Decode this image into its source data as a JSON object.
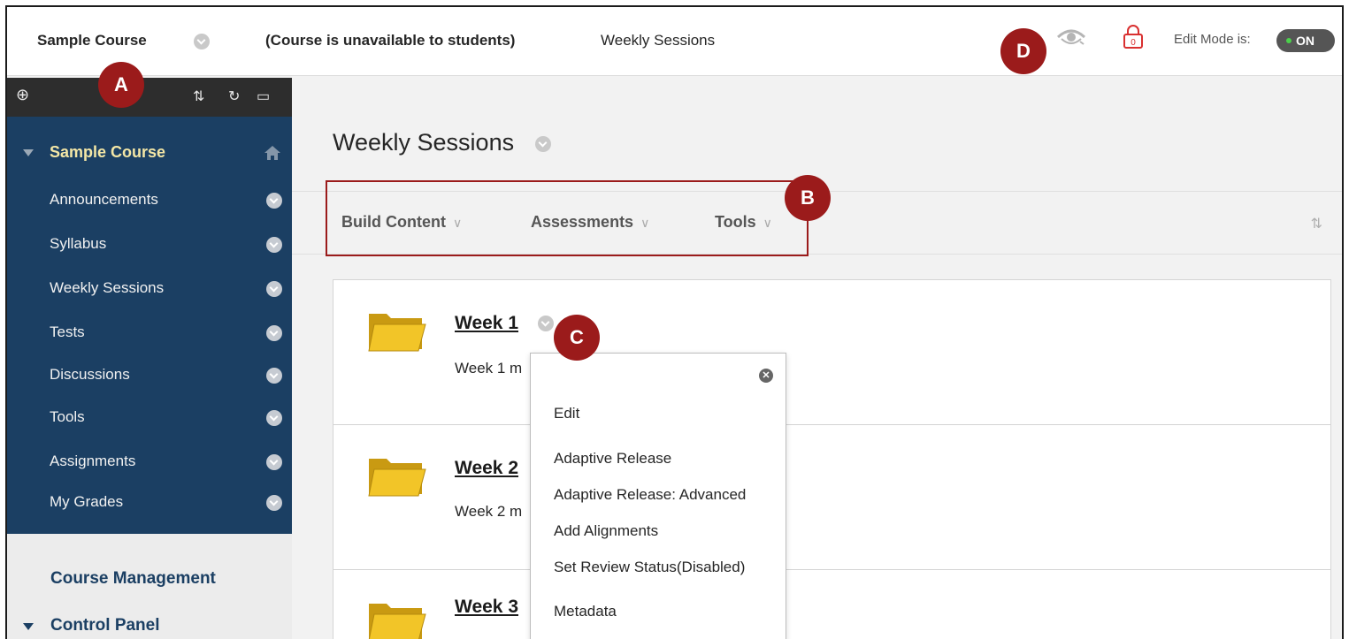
{
  "topbar": {
    "course_title": "Sample Course",
    "availability": "(Course is unavailable to students)",
    "breadcrumb": "Weekly Sessions",
    "lock_count": "0",
    "edit_mode_label": "Edit Mode is:",
    "edit_mode_value": "ON"
  },
  "badges": {
    "a": "A",
    "b": "B",
    "c": "C",
    "d": "D"
  },
  "sidebar": {
    "toolbar_icons": [
      "add-icon",
      "sort-icon",
      "refresh-icon",
      "folder-icon"
    ],
    "course_name": "Sample Course",
    "items": [
      {
        "label": "Announcements"
      },
      {
        "label": "Syllabus"
      },
      {
        "label": "Weekly Sessions"
      },
      {
        "label": "Tests"
      },
      {
        "label": "Discussions"
      },
      {
        "label": "Tools"
      },
      {
        "label": "Assignments"
      },
      {
        "label": "My Grades"
      }
    ],
    "course_management": "Course Management",
    "control_panel": "Control Panel"
  },
  "main": {
    "page_title": "Weekly Sessions",
    "actions": [
      {
        "label": "Build Content"
      },
      {
        "label": "Assessments"
      },
      {
        "label": "Tools"
      }
    ],
    "content_items": [
      {
        "title": "Week 1",
        "description": "Week 1 m"
      },
      {
        "title": "Week 2",
        "description": "Week 2 m"
      },
      {
        "title": "Week 3",
        "description": ""
      }
    ]
  },
  "context_menu": {
    "items": [
      {
        "label": "Edit"
      },
      {
        "label": "Adaptive Release"
      },
      {
        "label": "Adaptive Release: Advanced"
      },
      {
        "label": "Add Alignments"
      },
      {
        "label": "Set Review Status(Disabled)"
      },
      {
        "label": "Metadata"
      }
    ]
  },
  "colors": {
    "sidebar_bg": "#1b3f63",
    "badge": "#9b1b1b",
    "course_name": "#f4e7a6"
  }
}
